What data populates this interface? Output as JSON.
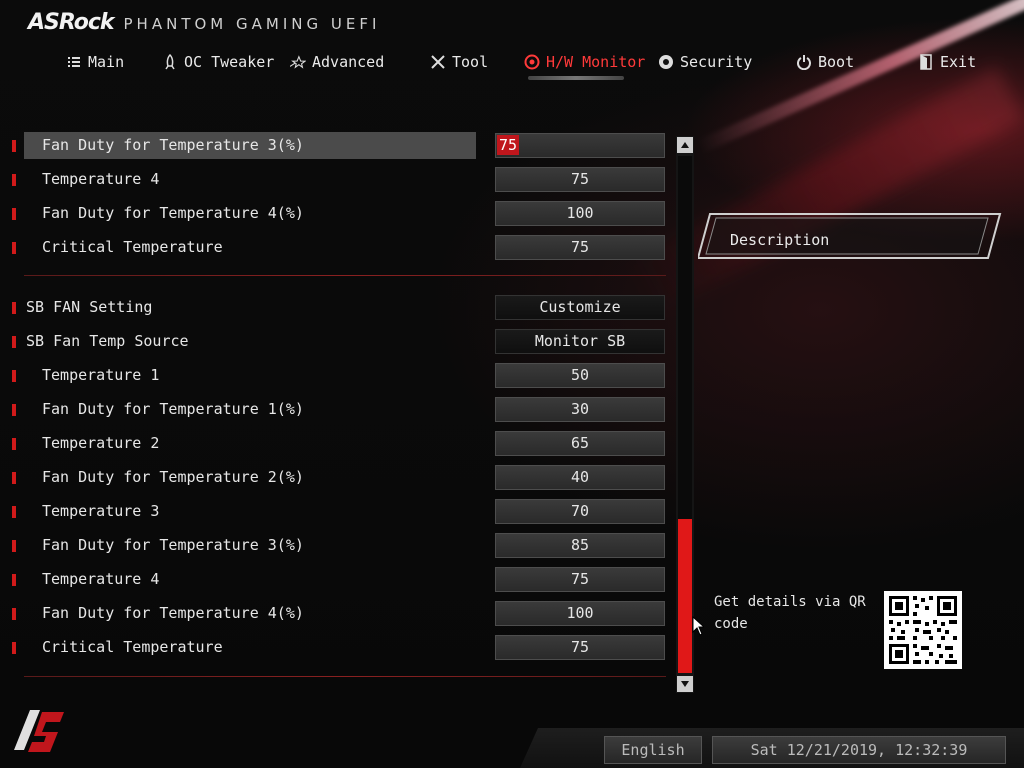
{
  "brand": {
    "name": "ASRock",
    "product": "PHANTOM GAMING UEFI"
  },
  "nav": {
    "tabs": [
      {
        "label": "Main",
        "icon": "list-icon"
      },
      {
        "label": "OC Tweaker",
        "icon": "rocket-icon"
      },
      {
        "label": "Advanced",
        "icon": "star-icon"
      },
      {
        "label": "Tool",
        "icon": "tools-icon"
      },
      {
        "label": "H/W Monitor",
        "icon": "gauge-icon"
      },
      {
        "label": "Security",
        "icon": "shield-icon"
      },
      {
        "label": "Boot",
        "icon": "power-icon"
      },
      {
        "label": "Exit",
        "icon": "exit-door-icon"
      }
    ],
    "active": "H/W Monitor"
  },
  "settings": {
    "group1": [
      {
        "label": "Fan Duty for Temperature 3(%)",
        "value": "75",
        "selected": true
      },
      {
        "label": "Temperature 4",
        "value": "75"
      },
      {
        "label": "Fan Duty for Temperature 4(%)",
        "value": "100"
      },
      {
        "label": "Critical Temperature",
        "value": "75"
      }
    ],
    "group2_header": [
      {
        "label": "SB FAN Setting",
        "value": "Customize"
      },
      {
        "label": "SB Fan Temp Source",
        "value": "Monitor SB"
      }
    ],
    "group2": [
      {
        "label": "Temperature 1",
        "value": "50"
      },
      {
        "label": "Fan Duty for Temperature 1(%)",
        "value": "30"
      },
      {
        "label": "Temperature 2",
        "value": "65"
      },
      {
        "label": "Fan Duty for Temperature 2(%)",
        "value": "40"
      },
      {
        "label": "Temperature 3",
        "value": "70"
      },
      {
        "label": "Fan Duty for Temperature 3(%)",
        "value": "85"
      },
      {
        "label": "Temperature 4",
        "value": "75"
      },
      {
        "label": "Fan Duty for Temperature 4(%)",
        "value": "100"
      },
      {
        "label": "Critical Temperature",
        "value": "75"
      }
    ]
  },
  "description": {
    "title": "Description"
  },
  "qr": {
    "text": "Get details via QR code"
  },
  "footer": {
    "language": "English",
    "datetime": "Sat 12/21/2019, 12:32:39"
  },
  "colors": {
    "accent": "#e01818",
    "text": "#e6e6e6"
  }
}
